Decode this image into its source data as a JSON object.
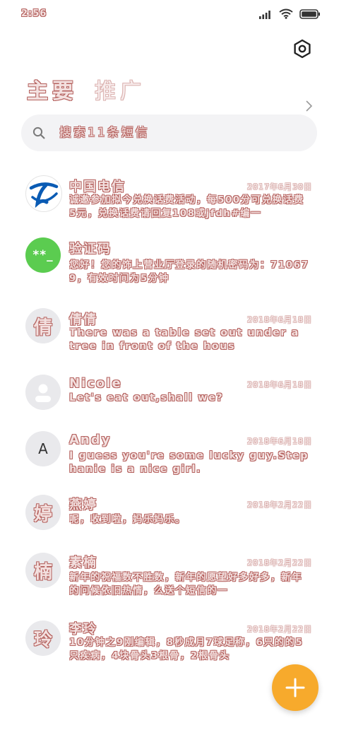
{
  "status_bar": {
    "time": "2:56",
    "icons": [
      "signal-icon",
      "wifi-icon",
      "battery-icon"
    ]
  },
  "header": {
    "tabs": [
      {
        "label": "主要",
        "active": true
      },
      {
        "label": "推广",
        "active": false
      }
    ]
  },
  "search": {
    "placeholder": "搜索11条短信"
  },
  "messages": [
    {
      "name": "中国电信",
      "date": "2017年6月30日",
      "preview": "诚邀参加拟今兑换话费活动，每500分可兑换话费5元，兑换话费请回复108或jfdh#编一",
      "avatar": "china-telecom-logo"
    },
    {
      "name": "验证码",
      "date": "",
      "preview": "您好！您的饰上营业厅登录的随机密码为：710679，有效时间为5分钟",
      "avatar_text": "**_"
    },
    {
      "name": "倩倩",
      "date": "2018年6月18日",
      "preview": "There was a table set out under a tree in front of the hous",
      "avatar_text": "倩"
    },
    {
      "name": "Nicole",
      "date": "2018年6月18日",
      "preview": "Let's eat out,shall we?",
      "avatar": "person-placeholder"
    },
    {
      "name": "Andy",
      "date": "2018年6月18日",
      "preview": "I guess you're some lucky guy.Stephanie is a nice girl.",
      "avatar_text": "A"
    },
    {
      "name": "燕婷",
      "date": "2018年2月22日",
      "preview": "呢，收到啦，妈乐妈乐。",
      "avatar_text": "婷"
    },
    {
      "name": "素楠",
      "date": "2018年2月22日",
      "preview": "新年的祝福数不胜数，新年的愿望好多好多，新年的问候依旧热情，么送个短信的一",
      "avatar_text": "楠"
    },
    {
      "name": "李玲",
      "date": "2018年2月22日",
      "preview": "10分钟之9刚编辑，8秒成月7球足称，6只的的5只疾病，4块骨头3根骨，2根骨头",
      "avatar_text": "玲"
    }
  ],
  "colors": {
    "accent_fab": "#f7aa2c",
    "verify_avatar": "#5bcc50",
    "telecom_blue": "#0a5bb4"
  }
}
